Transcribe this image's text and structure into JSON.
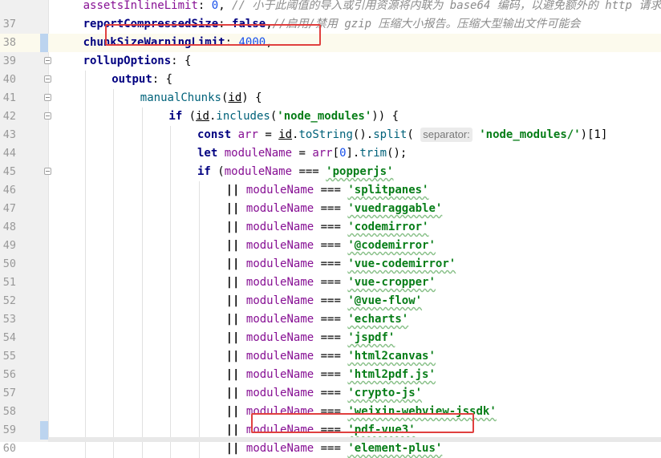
{
  "editor": {
    "lines": [
      {
        "n": "",
        "indent": 4,
        "segs": [
          [
            "prop",
            "assetsInlineLimit"
          ],
          [
            "var",
            ": "
          ],
          [
            "num",
            "0"
          ],
          [
            "var",
            ","
          ],
          [
            "cmt",
            " // 小于此阈值的导入或引用资源将内联为 base64 编码，以避免额外的 http 请求"
          ]
        ],
        "clip": true
      },
      {
        "n": "37",
        "indent": 4,
        "segs": [
          [
            "propb",
            "reportCompressedSize"
          ],
          [
            "var",
            ": "
          ],
          [
            "kw",
            "false"
          ],
          [
            "var",
            ","
          ],
          [
            "cmt",
            "//启用/禁用 gzip 压缩大小报告。压缩大型输出文件可能会"
          ]
        ]
      },
      {
        "n": "38",
        "indent": 4,
        "segs": [
          [
            "propb",
            "chunkSizeWarningLimit"
          ],
          [
            "var",
            ": "
          ],
          [
            "num",
            "4000"
          ],
          [
            "var",
            ","
          ]
        ],
        "current": true
      },
      {
        "n": "39",
        "indent": 4,
        "segs": [
          [
            "propb",
            "rollupOptions"
          ],
          [
            "var",
            ": {"
          ]
        ],
        "fold": true
      },
      {
        "n": "40",
        "indent": 8,
        "segs": [
          [
            "propb",
            "output"
          ],
          [
            "var",
            ": {"
          ]
        ],
        "fold": true
      },
      {
        "n": "41",
        "indent": 12,
        "segs": [
          [
            "fn",
            "manualChunks"
          ],
          [
            "var",
            "("
          ],
          [
            "lvu",
            "id"
          ],
          [
            "var",
            ") {"
          ]
        ],
        "fold": true
      },
      {
        "n": "42",
        "indent": 16,
        "segs": [
          [
            "kw",
            "if"
          ],
          [
            "var",
            " ("
          ],
          [
            "lvu",
            "id"
          ],
          [
            "var",
            "."
          ],
          [
            "fn",
            "includes"
          ],
          [
            "var",
            "("
          ],
          [
            "str",
            "'node_modules'"
          ],
          [
            "var",
            ")) {"
          ]
        ],
        "fold": true
      },
      {
        "n": "43",
        "indent": 20,
        "segs": [
          [
            "kw",
            "const"
          ],
          [
            "var",
            " "
          ],
          [
            "lv2",
            "arr"
          ],
          [
            "var",
            " = "
          ],
          [
            "lvu",
            "id"
          ],
          [
            "var",
            "."
          ],
          [
            "fn",
            "toString"
          ],
          [
            "var",
            "()."
          ],
          [
            "fn",
            "split"
          ],
          [
            "var",
            "( "
          ],
          [
            "hint",
            "separator:"
          ],
          [
            "var",
            " "
          ],
          [
            "str",
            "'node_modules/'"
          ],
          [
            "var",
            ")[1]"
          ]
        ]
      },
      {
        "n": "44",
        "indent": 20,
        "segs": [
          [
            "kw",
            "let"
          ],
          [
            "var",
            " "
          ],
          [
            "lv2",
            "moduleName"
          ],
          [
            "var",
            " = "
          ],
          [
            "lv2",
            "arr"
          ],
          [
            "var",
            "["
          ],
          [
            "num",
            "0"
          ],
          [
            "var",
            "]."
          ],
          [
            "fn",
            "trim"
          ],
          [
            "var",
            "();"
          ]
        ]
      },
      {
        "n": "45",
        "indent": 20,
        "segs": [
          [
            "kw",
            "if"
          ],
          [
            "var",
            " ("
          ],
          [
            "lv2",
            "moduleName"
          ],
          [
            "var",
            " === "
          ],
          [
            "strw",
            "'popperjs'"
          ]
        ],
        "fold": true
      },
      {
        "n": "46",
        "indent": 24,
        "mod": "'splitpanes'"
      },
      {
        "n": "47",
        "indent": 24,
        "mod": "'vuedraggable'"
      },
      {
        "n": "48",
        "indent": 24,
        "mod": "'codemirror'"
      },
      {
        "n": "49",
        "indent": 24,
        "mod": "'@codemirror'"
      },
      {
        "n": "50",
        "indent": 24,
        "mod": "'vue-codemirror'"
      },
      {
        "n": "51",
        "indent": 24,
        "mod": "'vue-cropper'"
      },
      {
        "n": "52",
        "indent": 24,
        "mod": "'@vue-flow'"
      },
      {
        "n": "53",
        "indent": 24,
        "mod": "'echarts'"
      },
      {
        "n": "54",
        "indent": 24,
        "mod": "'jspdf'"
      },
      {
        "n": "55",
        "indent": 24,
        "mod": "'html2canvas'"
      },
      {
        "n": "56",
        "indent": 24,
        "mod": "'html2pdf.js'"
      },
      {
        "n": "57",
        "indent": 24,
        "mod": "'crypto-js'"
      },
      {
        "n": "58",
        "indent": 24,
        "mod": "'weixin-webview-jssdk'"
      },
      {
        "n": "59",
        "indent": 24,
        "mod": "'pdf-vue3'",
        "mark": true
      },
      {
        "n": "60",
        "indent": 24,
        "mod": "'element-plus'"
      }
    ],
    "or_op": "||",
    "var_name": "moduleName",
    "eq_op": "==="
  },
  "colors": {
    "highlight_box": "#e0403f",
    "gutter": "#f0f0f0",
    "current_line": "#fcfaed"
  }
}
